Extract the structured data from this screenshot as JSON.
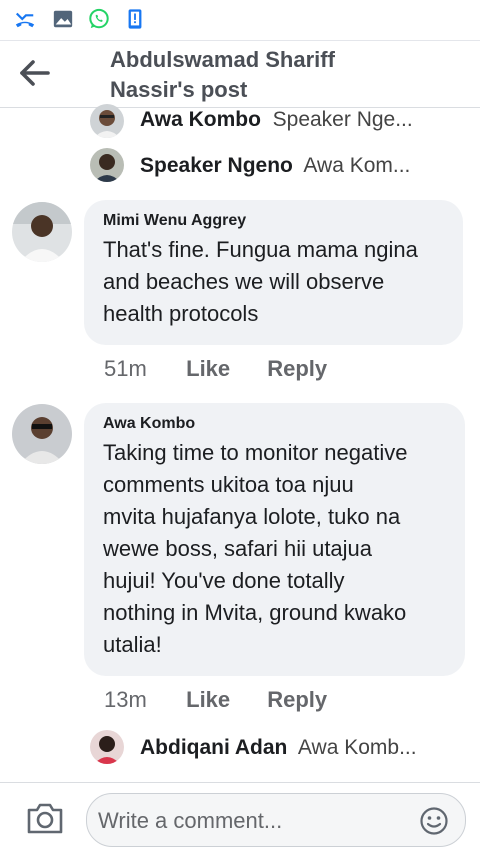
{
  "header": {
    "title_line1": "Abdulswamad Shariff",
    "title_line2": "Nassir's post"
  },
  "replies_top": [
    {
      "author": "Awa Kombo",
      "preview": "Speaker Nge..."
    },
    {
      "author": "Speaker Ngeno",
      "preview": "Awa Kom..."
    }
  ],
  "comments": [
    {
      "author": "Mimi Wenu Aggrey",
      "lines": [
        "That's fine. Fungua mama ngina",
        "and beaches we will observe",
        "health protocols"
      ],
      "time": "51m",
      "like_label": "Like",
      "reply_label": "Reply"
    },
    {
      "author": "Awa Kombo",
      "lines": [
        "Taking time to monitor negative",
        "comments ukitoa toa njuu",
        "mvita hujafanya lolote, tuko na",
        "wewe boss, safari hii utajua",
        "hujui! You've done totally",
        "nothing in Mvita, ground kwako",
        "utalia!"
      ],
      "time": "13m",
      "like_label": "Like",
      "reply_label": "Reply"
    }
  ],
  "reply_bottom": {
    "author": "Abdiqani Adan",
    "preview": "Awa Komb..."
  },
  "composer": {
    "placeholder": "Write a comment..."
  },
  "colors": {
    "bubble": "#f0f2f5",
    "accent": "#1877f2",
    "whatsapp": "#25d366"
  }
}
